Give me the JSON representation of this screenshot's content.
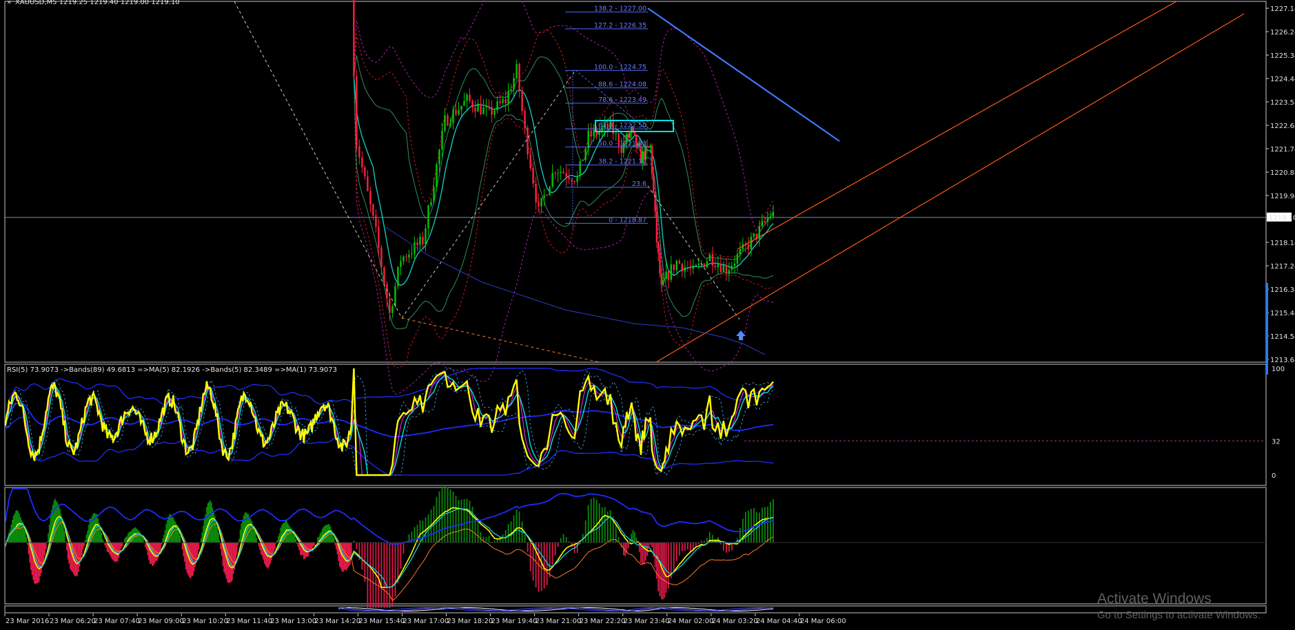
{
  "main_panel": {
    "header": "XAUUSD,M5  1219.25 1219.40 1219.00 1219.10"
  },
  "rsi_panel": {
    "header": "RSI(5) 73.9073  ->Bands(89) 49.6813  =>MA(5) 82.1926  ->Bands(5) 82.3489  =>MA(1) 73.9073",
    "scale_labels": [
      "100",
      "32",
      "0"
    ]
  },
  "watermark": {
    "line1": "Activate Windows",
    "line2": "Go to Settings to activate Windows."
  },
  "colors": {
    "background": "#000000",
    "bull": "#00c800",
    "bear": "#ff2040",
    "rsi": "#ffff00",
    "ma": "#00e5e5",
    "band": "#1f2bff",
    "trend": "#ff5a14",
    "fib": "#4f6bff",
    "highlight_box": "#00e5e5"
  },
  "chart_data": [
    {
      "type": "candlestick",
      "title": "XAUUSD,M5",
      "ylim": [
        1213.64,
        1227.6
      ],
      "y_ticks": [
        "1227.14",
        "1226.24",
        "1225.34",
        "1224.44",
        "1223.54",
        "1222.64",
        "1221.74",
        "1220.84",
        "1219.94",
        "1219.10",
        "1218.14",
        "1217.24",
        "1216.34",
        "1215.44",
        "1214.54",
        "1213.64"
      ],
      "current_price": "1219.10",
      "x_tick_labels": [
        "23 Mar 2016",
        "23 Mar 06:20",
        "23 Mar 07:40",
        "23 Mar 09:00",
        "23 Mar 10:20",
        "23 Mar 11:40",
        "23 Mar 13:00",
        "23 Mar 14:20",
        "23 Mar 15:40",
        "23 Mar 17:00",
        "23 Mar 18:20",
        "23 Mar 19:40",
        "23 Mar 21:00",
        "23 Mar 22:20",
        "23 Mar 23:40",
        "24 Mar 02:00",
        "24 Mar 03:20",
        "24 Mar 04:40",
        "24 Mar 06:00"
      ],
      "anchors": [
        [
          "23 Mar 15:30",
          1227.6
        ],
        [
          "23 Mar 15:40",
          1222.0
        ],
        [
          "23 Mar 16:15",
          1218.5
        ],
        [
          "23 Mar 16:40",
          1215.4
        ],
        [
          "23 Mar 17:00",
          1217.5
        ],
        [
          "23 Mar 17:40",
          1218.2
        ],
        [
          "23 Mar 18:20",
          1222.8
        ],
        [
          "23 Mar 19:00",
          1223.6
        ],
        [
          "23 Mar 19:40",
          1223.1
        ],
        [
          "23 Mar 20:10",
          1223.6
        ],
        [
          "23 Mar 20:30",
          1224.75
        ],
        [
          "23 Mar 20:45",
          1222.4
        ],
        [
          "23 Mar 21:10",
          1219.3
        ],
        [
          "23 Mar 21:30",
          1220.5
        ],
        [
          "23 Mar 21:40",
          1221.0
        ],
        [
          "23 Mar 22:20",
          1220.6
        ],
        [
          "23 Mar 22:40",
          1222.2
        ],
        [
          "23 Mar 23:20",
          1222.6
        ],
        [
          "23 Mar 23:40",
          1221.8
        ],
        [
          "24 Mar 00:10",
          1222.4
        ],
        [
          "24 Mar 00:40",
          1221.4
        ],
        [
          "24 Mar 01:10",
          1221.8
        ],
        [
          "24 Mar 01:30",
          1218.2
        ],
        [
          "24 Mar 01:45",
          1216.3
        ],
        [
          "24 Mar 02:20",
          1217.4
        ],
        [
          "24 Mar 02:50",
          1217.0
        ],
        [
          "24 Mar 03:20",
          1217.6
        ],
        [
          "24 Mar 03:50",
          1217.1
        ],
        [
          "24 Mar 04:40",
          1218.3
        ],
        [
          "24 Mar 05:10",
          1219.2
        ]
      ],
      "fibonacci": [
        {
          "level": "138.2",
          "price": "1227.00"
        },
        {
          "level": "127.2",
          "price": "1226.35"
        },
        {
          "level": "100.0",
          "price": "1224.75"
        },
        {
          "level": "88.6",
          "price": "1224.08"
        },
        {
          "level": "78.6",
          "price": "1223.49"
        },
        {
          "level": "61.8",
          "price": "1222.50"
        },
        {
          "level": "50.0",
          "price": "1221.81"
        },
        {
          "level": "38.2",
          "price": "1221.12"
        },
        {
          "level": "23.6",
          "price": ""
        },
        {
          "level": "0",
          "price": "1218.87"
        }
      ],
      "grid": false,
      "legend": "none"
    },
    {
      "type": "line",
      "title": "RSI(5)",
      "ylim": [
        0,
        100
      ],
      "y_ticks": [
        "100",
        "32",
        "0"
      ],
      "series": [
        {
          "name": "RSI(5)",
          "last": 73.9073
        },
        {
          "name": "Bands(89)",
          "last": 49.6813
        },
        {
          "name": "MA(5)",
          "last": 82.1926
        },
        {
          "name": "Bands(5)",
          "last": 82.3489
        },
        {
          "name": "MA(1)",
          "last": 73.9073
        }
      ]
    },
    {
      "type": "bar",
      "title": "",
      "note": "histogram oscillator with overlay lines, no printed labels"
    }
  ]
}
